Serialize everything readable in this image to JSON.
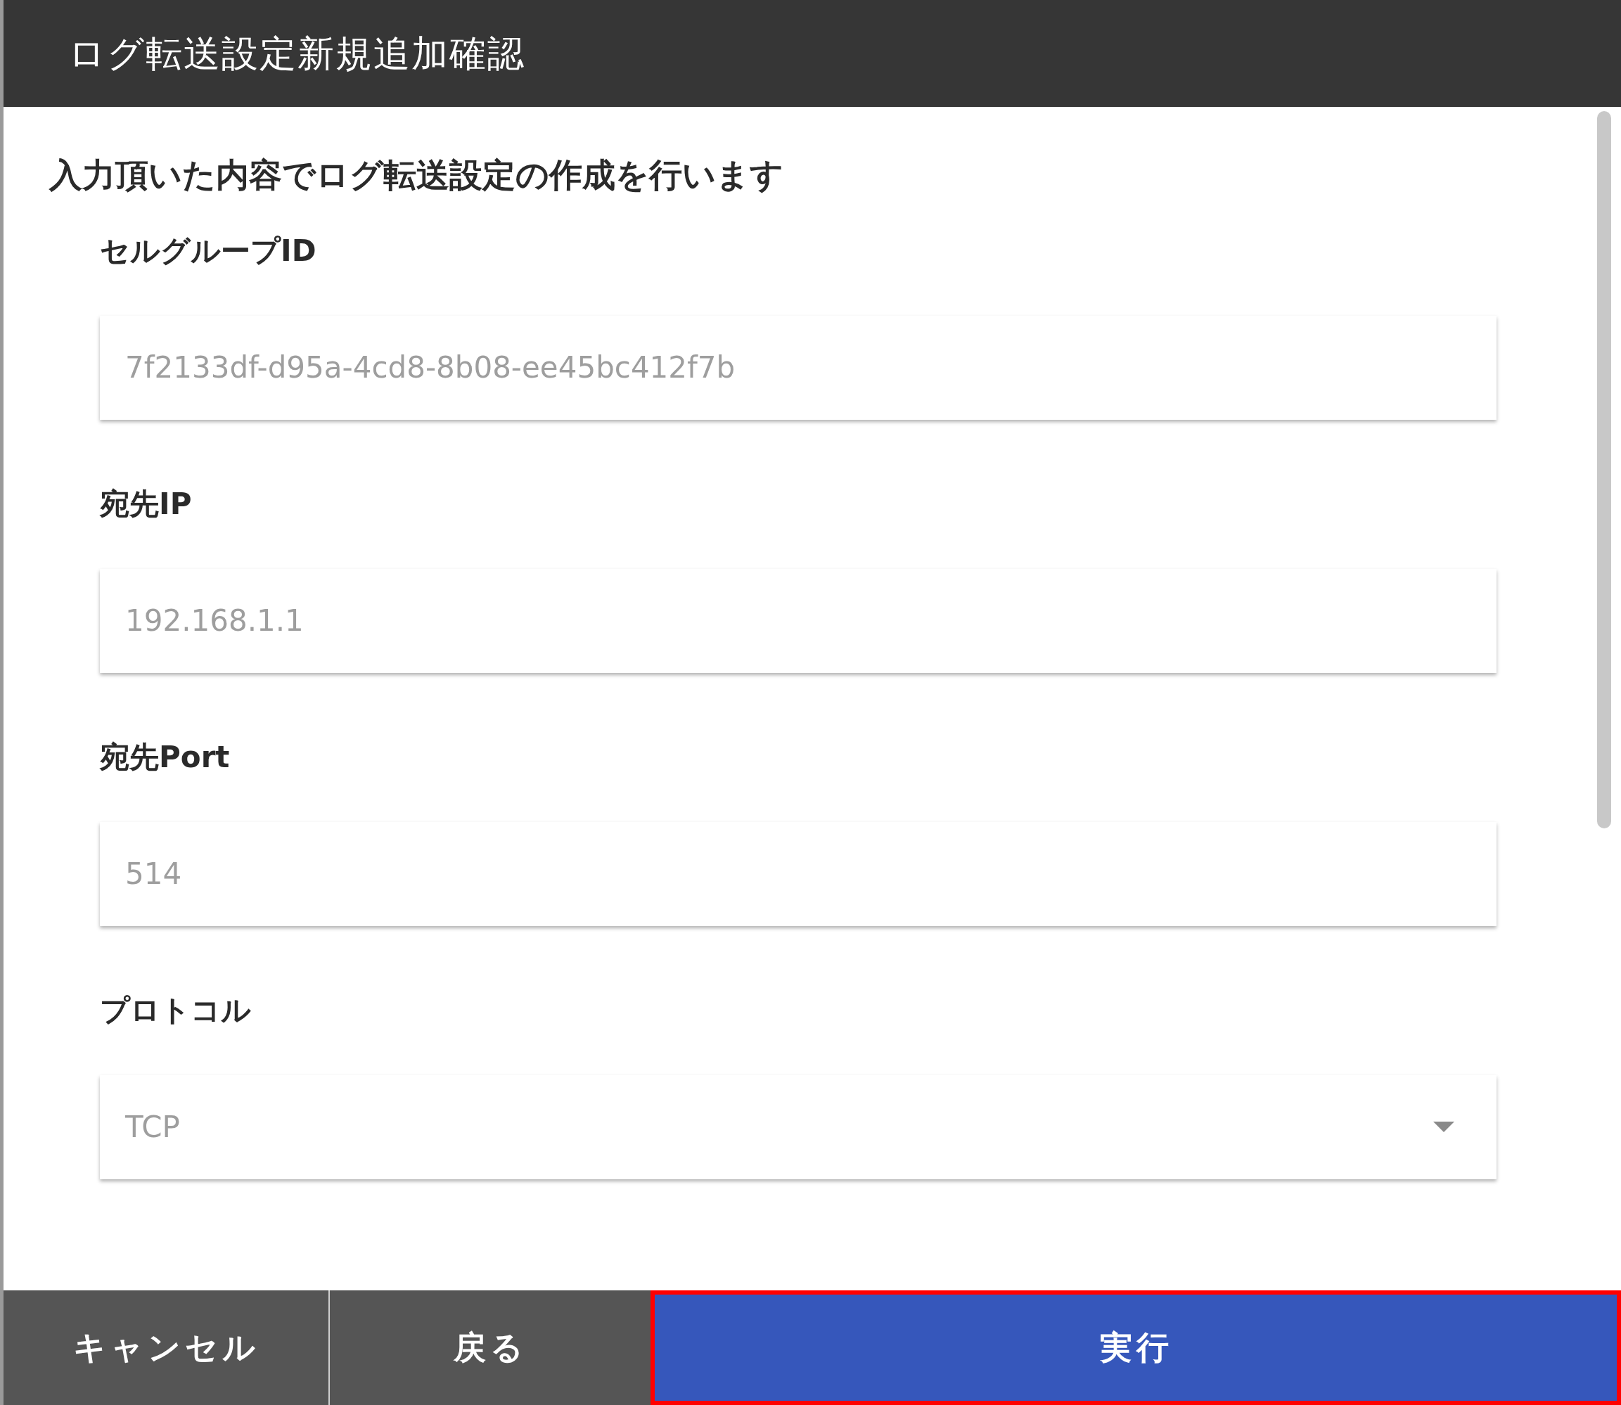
{
  "window": {
    "title": "ログ転送設定新規追加確認"
  },
  "message": "入力頂いた内容でログ転送設定の作成を行います",
  "fields": [
    {
      "label": "セルグループID",
      "kind": "text",
      "value": "7f2133df-d95a-4cd8-8b08-ee45bc412f7b"
    },
    {
      "label": "宛先IP",
      "kind": "text",
      "value": "192.168.1.1"
    },
    {
      "label": "宛先Port",
      "kind": "text",
      "value": "514"
    },
    {
      "label": "プロトコル",
      "kind": "select",
      "value": "TCP"
    }
  ],
  "buttons": [
    {
      "label": "キャンセル",
      "kind": "secondary",
      "highlighted": false
    },
    {
      "label": "戻る",
      "kind": "secondary",
      "highlighted": false
    },
    {
      "label": "実行",
      "kind": "primary",
      "highlighted": true
    }
  ]
}
